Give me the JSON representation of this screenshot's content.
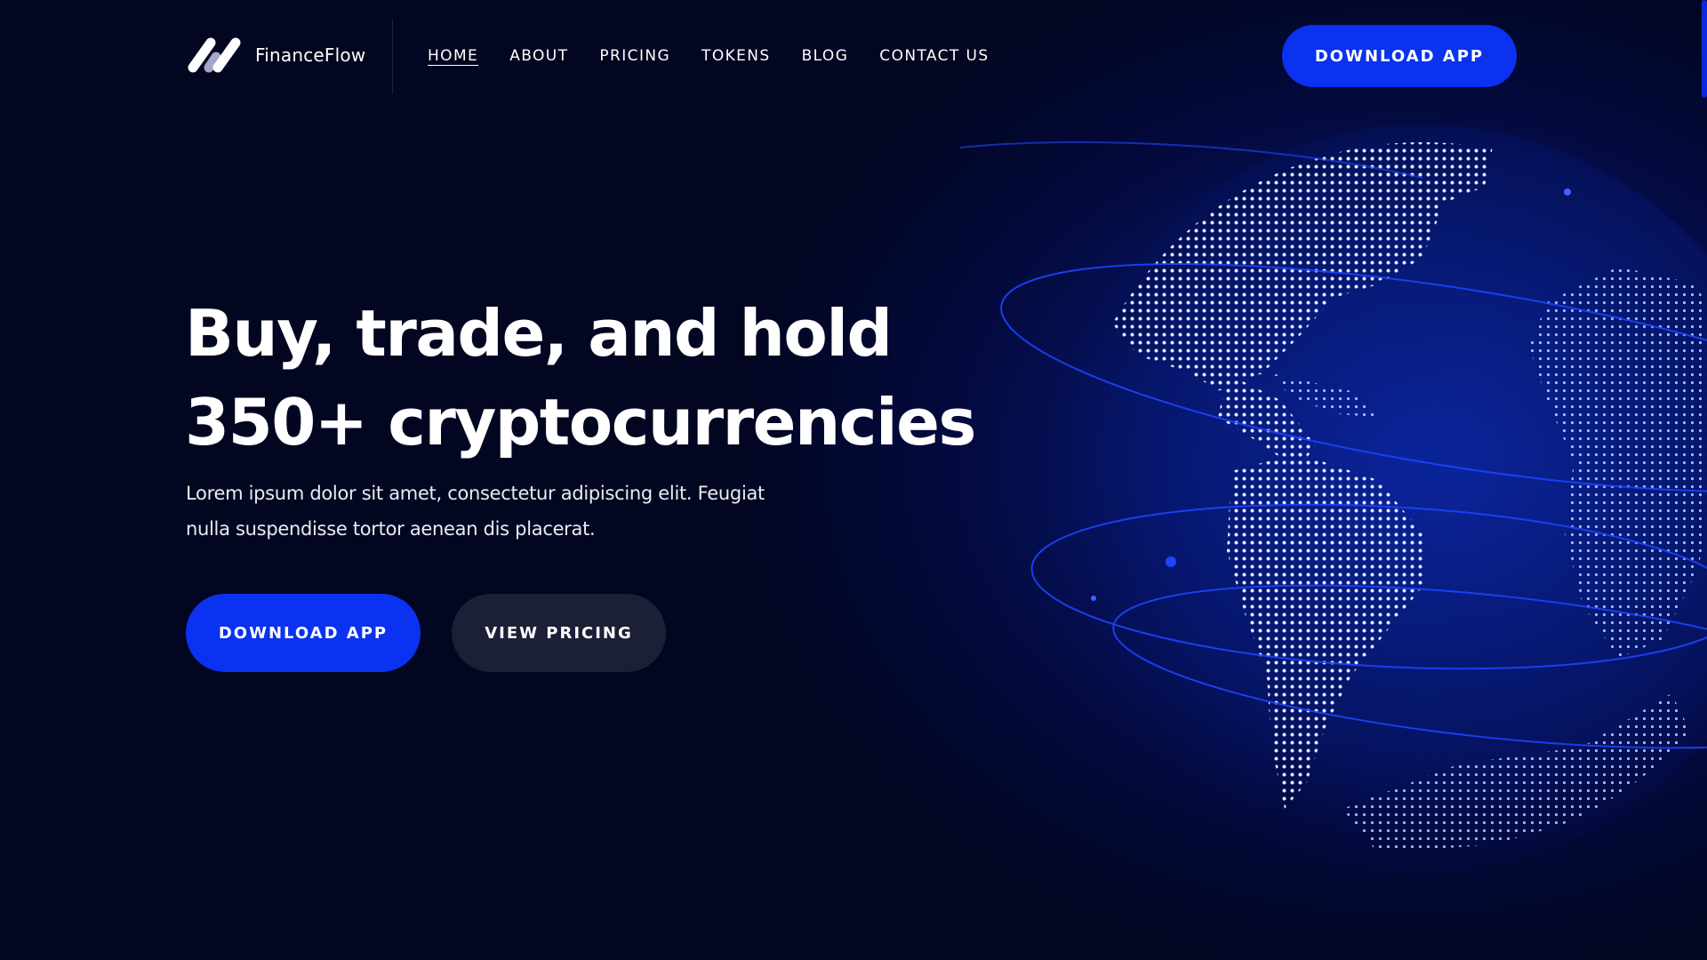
{
  "brand": {
    "name": "FinanceFlow",
    "logo_icon": "financeflow-logo-icon"
  },
  "nav": {
    "items": [
      {
        "label": "HOME",
        "active": true
      },
      {
        "label": "ABOUT",
        "active": false
      },
      {
        "label": "PRICING",
        "active": false
      },
      {
        "label": "TOKENS",
        "active": false
      },
      {
        "label": "BLOG",
        "active": false
      },
      {
        "label": "CONTACT US",
        "active": false
      }
    ],
    "cta_label": "DOWNLOAD APP"
  },
  "hero": {
    "title_line1": "Buy, trade, and hold",
    "title_line2": "350+ cryptocurrencies",
    "subtitle_line1": "Lorem ipsum dolor sit amet, consectetur adipiscing elit. Feugiat",
    "subtitle_line2": "nulla suspendisse tortor aenean dis placerat.",
    "primary_button": "DOWNLOAD APP",
    "secondary_button": "VIEW PRICING",
    "illustration": "dotted-globe-icon"
  },
  "colors": {
    "background": "#020620",
    "accent": "#0a32f0",
    "secondary_button": "#1b2036",
    "globe_glow": "#0a1f8f"
  }
}
